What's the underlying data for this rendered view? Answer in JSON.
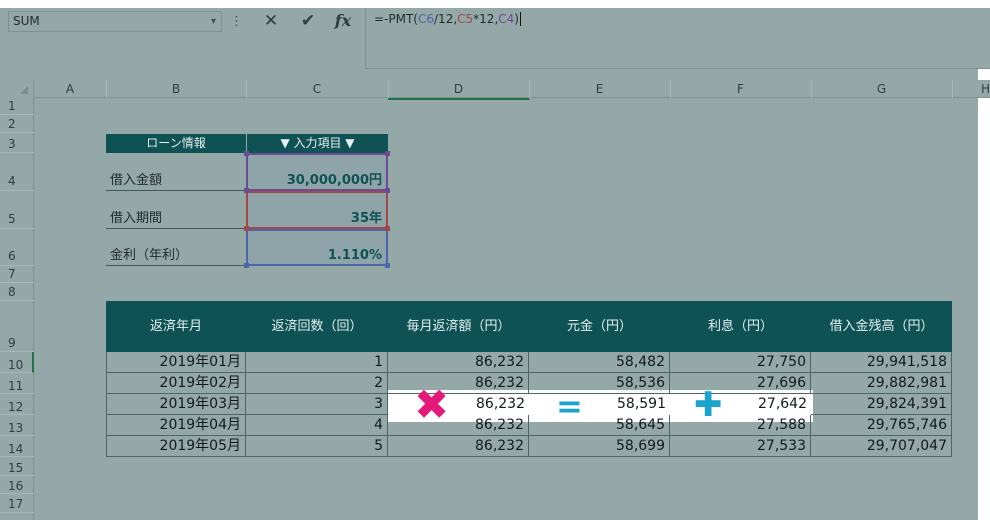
{
  "namebox": {
    "value": "SUM",
    "arrow": "▾"
  },
  "formula_bar": {
    "dots": "⋮",
    "cancel_icon": "✕",
    "enter_icon": "✔",
    "fx_label": "fx",
    "formula_prefix": "=-PMT(",
    "ref_c6": "C6",
    "mid1": "/12,",
    "ref_c5": "C5",
    "mid2": "*12,",
    "ref_c4": "C4",
    "suffix": ")"
  },
  "columns": [
    "A",
    "B",
    "C",
    "D",
    "E",
    "F",
    "G",
    "H"
  ],
  "rows": [
    "1",
    "2",
    "3",
    "4",
    "5",
    "6",
    "7",
    "8",
    "9",
    "10",
    "11",
    "12",
    "13",
    "14",
    "15",
    "16",
    "17"
  ],
  "loan_info": {
    "header_label": "ローン情報",
    "header_input": "▼ 入力項目 ▼",
    "items": [
      {
        "label": "借入金額",
        "value": "30,000,000円"
      },
      {
        "label": "借入期間",
        "value": "35年"
      },
      {
        "label": "金利（年利）",
        "value": "1.110%"
      }
    ]
  },
  "schedule": {
    "headers": [
      "返済年月",
      "返済回数（回）",
      "毎月返済額（円）",
      "元金（円）",
      "利息（円）",
      "借入金残高（円）"
    ],
    "rows": [
      [
        "2019年01月",
        "1",
        "86,232",
        "58,482",
        "27,750",
        "29,941,518"
      ],
      [
        "2019年02月",
        "2",
        "86,232",
        "58,536",
        "27,696",
        "29,882,981"
      ],
      [
        "2019年03月",
        "3",
        "86,232",
        "58,591",
        "27,642",
        "29,824,391"
      ],
      [
        "2019年04月",
        "4",
        "86,232",
        "58,645",
        "27,588",
        "29,765,746"
      ],
      [
        "2019年05月",
        "5",
        "86,232",
        "58,699",
        "27,533",
        "29,707,047"
      ]
    ]
  },
  "annotations": {
    "times": "✖",
    "equals": "=",
    "plus": "✚"
  },
  "colors": {
    "header_bg": "#0e5255",
    "sheet_overlay": "#95a8a8",
    "times": "#e4197a",
    "equals_plus": "#1aa3cc"
  }
}
